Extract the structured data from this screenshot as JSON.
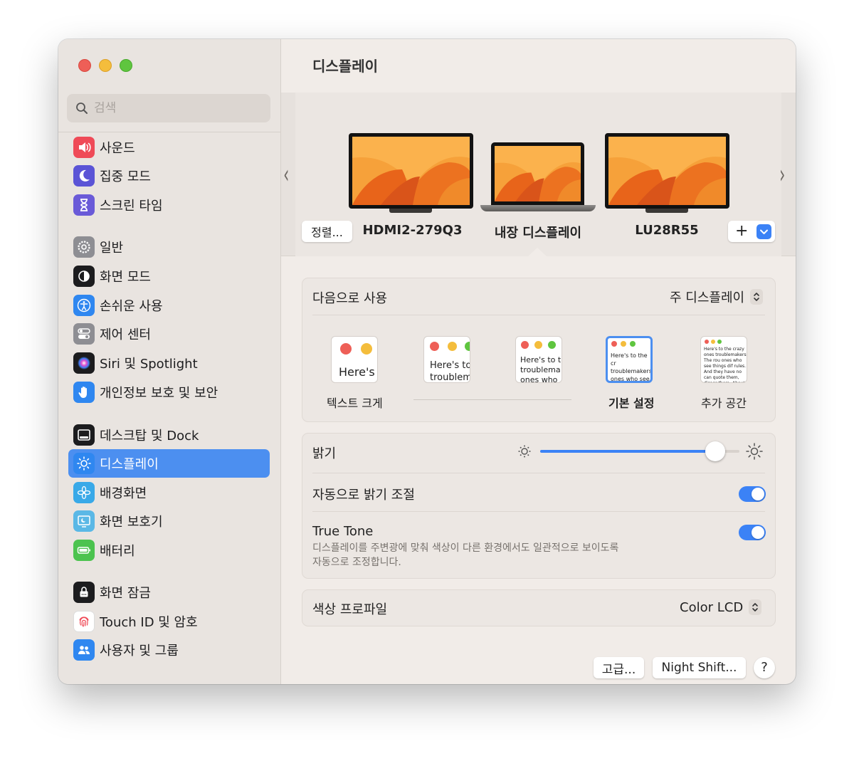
{
  "sidebar": {
    "search_placeholder": "검색",
    "items": [
      {
        "label": "사운드",
        "icon": "speaker-icon",
        "color": "#ef4a57"
      },
      {
        "label": "집중 모드",
        "icon": "moon-icon",
        "color": "#5b54d6"
      },
      {
        "label": "스크린 타임",
        "icon": "hourglass-icon",
        "color": "#6a5ad8"
      },
      {
        "label": "일반",
        "icon": "gear-icon",
        "color": "#8e8e93"
      },
      {
        "label": "화면 모드",
        "icon": "appearance-icon",
        "color": "#1c1c1e"
      },
      {
        "label": "손쉬운 사용",
        "icon": "accessibility-icon",
        "color": "#2f87f0"
      },
      {
        "label": "제어 센터",
        "icon": "control-center-icon",
        "color": "#8e8e93"
      },
      {
        "label": "Siri 및 Spotlight",
        "icon": "siri-icon",
        "color": "#1c1c1e"
      },
      {
        "label": "개인정보 보호 및 보안",
        "icon": "hand-icon",
        "color": "#2f87f0"
      },
      {
        "label": "데스크탑 및 Dock",
        "icon": "dock-icon",
        "color": "#1c1c1e"
      },
      {
        "label": "디스플레이",
        "icon": "sun-icon",
        "color": "#2f87f0"
      },
      {
        "label": "배경화면",
        "icon": "flower-icon",
        "color": "#39a9e8"
      },
      {
        "label": "화면 보호기",
        "icon": "screensaver-icon",
        "color": "#5ab8e6"
      },
      {
        "label": "배터리",
        "icon": "battery-icon",
        "color": "#4cc34f"
      },
      {
        "label": "화면 잠금",
        "icon": "lock-icon",
        "color": "#1c1c1e"
      },
      {
        "label": "Touch ID 및 암호",
        "icon": "fingerprint-icon",
        "color": "#ffffff"
      },
      {
        "label": "사용자 및 그룹",
        "icon": "users-icon",
        "color": "#2f87f0"
      }
    ],
    "selected_index": 10
  },
  "page": {
    "title": "디스플레이"
  },
  "arrangement": {
    "arrange_button": "정렬...",
    "displays": [
      {
        "name": "HDMI2-279Q3"
      },
      {
        "name": "내장 디스플레이"
      },
      {
        "name": "LU28R55"
      }
    ],
    "add_button": "+"
  },
  "use_as": {
    "label": "다음으로 사용",
    "value": "주 디스플레이"
  },
  "resolution": {
    "options": [
      {
        "caption": "텍스트 크게",
        "text": "Here's"
      },
      {
        "caption": "",
        "text": "Here's to troublem"
      },
      {
        "caption": "",
        "text": "Here's to t troublema ones who"
      },
      {
        "caption": "기본 설정",
        "text": "Here's to the cr troublemakers. ones who see t rules. And they"
      },
      {
        "caption": "추가 공간",
        "text": "Here's to the crazy ones troublemakers. The rou ones who see things dif rules. And they have no can quote them, disagr them. About the only th Because they change t"
      }
    ],
    "selected_index": 3
  },
  "brightness": {
    "label": "밝기",
    "value": 0.88
  },
  "auto_brightness": {
    "label": "자동으로 밝기 조절",
    "on": true
  },
  "true_tone": {
    "label": "True Tone",
    "description_line1": "디스플레이를 주변광에 맞춰 색상이 다른 환경에서도 일관적으로 보이도록",
    "description_line2": "자동으로 조정합니다.",
    "on": true
  },
  "color_profile": {
    "label": "색상 프로파일",
    "value": "Color LCD"
  },
  "footer": {
    "advanced": "고급...",
    "night_shift": "Night Shift...",
    "help": "?"
  },
  "colors": {
    "accent": "#3b82f6",
    "selection": "#4c8ff0"
  }
}
